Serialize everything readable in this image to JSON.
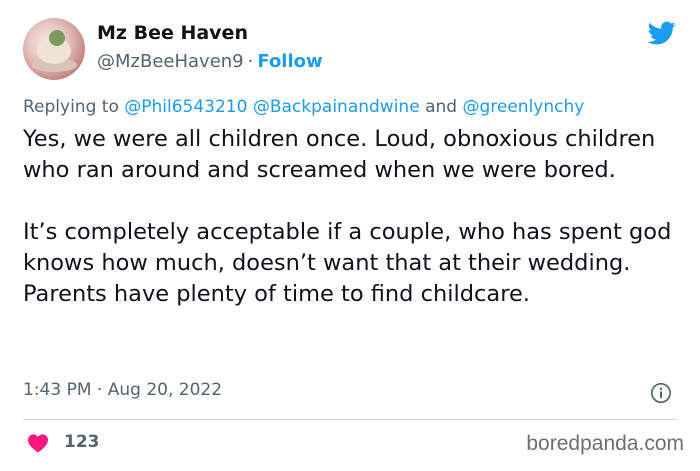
{
  "tweet": {
    "author_name": "Mz Bee Haven",
    "author_handle": "@MzBeeHaven9",
    "separator": "·",
    "follow_label": "Follow",
    "replying_to_prefix": "Replying to",
    "mentions": [
      "@Phil6543210",
      "@Backpainandwine",
      "@greenlynchy"
    ],
    "mention_joiner": "and",
    "paragraphs": [
      "Yes, we were all children once. Loud, obnoxious children who ran around and screamed when we were bored.",
      "It’s completely acceptable if a couple, who has spent god knows how much, doesn’t want that at their wedding. Parents have plenty of time to find childcare."
    ],
    "time": "1:43 PM",
    "date": "Aug 20, 2022",
    "likes_count": "123"
  },
  "icons": {
    "logo": "twitter-bird-icon",
    "info": "info-icon",
    "like": "heart-icon"
  },
  "colors": {
    "accent": "#1d9bf0",
    "heart": "#f91880",
    "secondary_text": "#536471"
  },
  "watermark": "boredpanda.com"
}
